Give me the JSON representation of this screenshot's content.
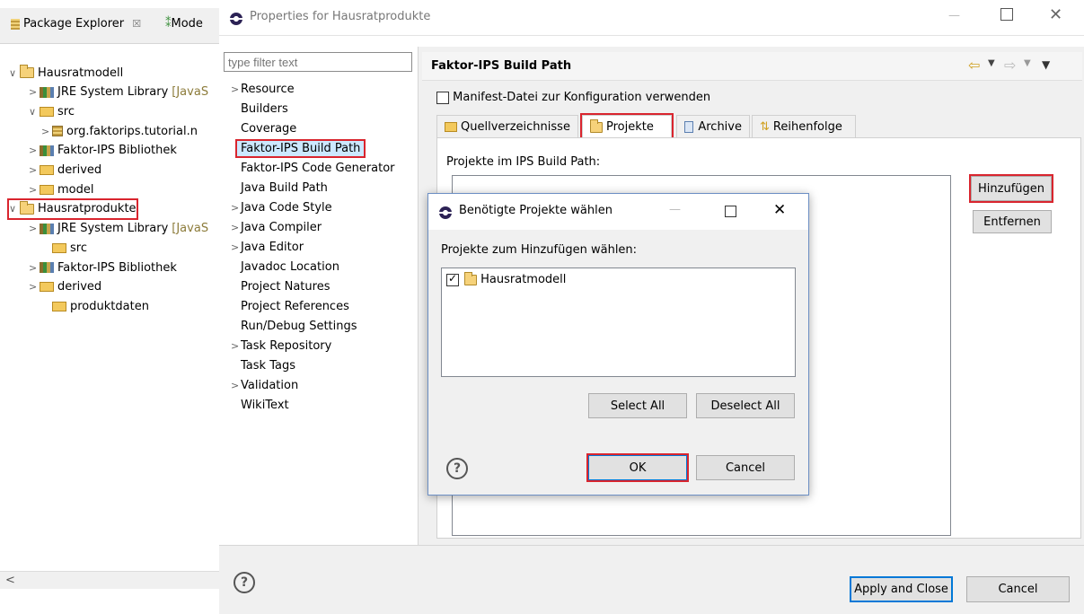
{
  "package_explorer": {
    "tab_label": "Package Explorer",
    "tab2_label": "Mode",
    "tree": [
      {
        "label": "Hausratmodell",
        "arrow": "∨",
        "icon": "ips-project-icon"
      },
      {
        "label": "JRE System Library",
        "suffix": "[JavaS",
        "arrow": ">",
        "icon": "library-icon"
      },
      {
        "label": "src",
        "arrow": "∨",
        "icon": "source-folder-icon"
      },
      {
        "label": "org.faktorips.tutorial.n",
        "arrow": ">",
        "icon": "package-icon"
      },
      {
        "label": "Faktor-IPS Bibliothek",
        "arrow": ">",
        "icon": "library-icon"
      },
      {
        "label": "derived",
        "arrow": ">",
        "icon": "source-folder-icon"
      },
      {
        "label": "model",
        "arrow": ">",
        "icon": "folder-icon"
      },
      {
        "label": "Hausratprodukte",
        "arrow": "∨",
        "icon": "ips-project-icon"
      },
      {
        "label": "JRE System Library",
        "suffix": "[JavaS",
        "arrow": ">",
        "icon": "library-icon"
      },
      {
        "label": "src",
        "arrow": "",
        "icon": "source-folder-icon"
      },
      {
        "label": "Faktor-IPS Bibliothek",
        "arrow": ">",
        "icon": "library-icon"
      },
      {
        "label": "derived",
        "arrow": ">",
        "icon": "source-folder-icon"
      },
      {
        "label": "produktdaten",
        "arrow": "",
        "icon": "folder-icon"
      }
    ],
    "scroll_left": "<"
  },
  "dialog": {
    "title": "Properties for Hausratprodukte",
    "filter_placeholder": "type filter text",
    "nav": [
      {
        "label": "Resource",
        "arrow": ">"
      },
      {
        "label": "Builders",
        "arrow": ""
      },
      {
        "label": "Coverage",
        "arrow": ""
      },
      {
        "label": "Faktor-IPS Build Path",
        "arrow": "",
        "selected": true
      },
      {
        "label": "Faktor-IPS Code Generator",
        "arrow": ""
      },
      {
        "label": "Java Build Path",
        "arrow": ""
      },
      {
        "label": "Java Code Style",
        "arrow": ">"
      },
      {
        "label": "Java Compiler",
        "arrow": ">"
      },
      {
        "label": "Java Editor",
        "arrow": ">"
      },
      {
        "label": "Javadoc Location",
        "arrow": ""
      },
      {
        "label": "Project Natures",
        "arrow": ""
      },
      {
        "label": "Project References",
        "arrow": ""
      },
      {
        "label": "Run/Debug Settings",
        "arrow": ""
      },
      {
        "label": "Task Repository",
        "arrow": ">"
      },
      {
        "label": "Task Tags",
        "arrow": ""
      },
      {
        "label": "Validation",
        "arrow": ">"
      },
      {
        "label": "WikiText",
        "arrow": ""
      }
    ],
    "page_title": "Faktor-IPS Build Path",
    "manifest_label": "Manifest-Datei zur Konfiguration verwenden",
    "tabs": [
      "Quellverzeichnisse",
      "Projekte",
      "Archive",
      "Reihenfolge"
    ],
    "active_tab": "Projekte",
    "projects_label": "Projekte im IPS Build Path:",
    "add_button": "Hinzufügen",
    "remove_button": "Entfernen",
    "apply_close": "Apply and Close",
    "cancel": "Cancel",
    "help": "?"
  },
  "modal": {
    "title": "Benötigte Projekte wählen",
    "prompt": "Projekte zum Hinzufügen wählen:",
    "items": [
      {
        "label": "Hausratmodell",
        "checked": true
      }
    ],
    "select_all": "Select All",
    "deselect_all": "Deselect All",
    "ok": "OK",
    "cancel": "Cancel",
    "help": "?"
  },
  "colors": {
    "highlight_red": "#d9252e",
    "selection_blue": "#cce8ff",
    "accent_blue": "#0078d7"
  }
}
